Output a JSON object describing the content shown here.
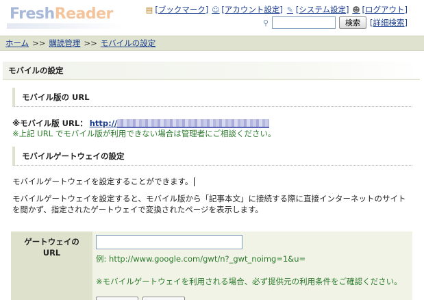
{
  "header": {
    "logo_fresh": "Fresh",
    "logo_reader": "Reader",
    "nav": [
      {
        "label": "[ブックマーク]",
        "icon": "bookmark-icon"
      },
      {
        "label": "[アカウント設定]",
        "icon": "account-icon"
      },
      {
        "label": "[システム設定]",
        "icon": "wrench-icon"
      },
      {
        "label": "[ログアウト]",
        "icon": "logout-icon"
      }
    ],
    "search": {
      "placeholder": "",
      "button": "検索",
      "advanced": "[詳細検索]"
    }
  },
  "breadcrumb": {
    "items": [
      "ホーム",
      "購読管理",
      "モバイルの設定"
    ],
    "separator": ">>"
  },
  "page": {
    "title": "モバイルの設定",
    "section1_title": "モバイル版の URL",
    "url_label": "※モバイル版 URL：",
    "url_prefix": "http://",
    "url_note": "※上記 URL でモバイル版が利用できない場合は管理者にご相談ください。",
    "section2_title": "モバイルゲートウェイの設定",
    "para1": "モバイルゲートウェイを設定することができます。",
    "para2": "モバイルゲートウェイを設定すると、モバイル版から「記事本文」に接続する際に直接インターネットのサイトを閲かず、指定されたゲートウェイで変換されたページを表示します。"
  },
  "form": {
    "label_line1": "ゲートウェイの",
    "label_line2": "URL",
    "input_value": "",
    "example": "例: http://www.google.com/gwt/n?_gwt_noimg=1&u=",
    "note": "※モバイルゲートウェイを利用される場合、必ず提供元の利用条件をご確認ください。"
  },
  "colors": {
    "link": "#1a3d8f",
    "note_green": "#2b7a2b",
    "breadcrumb_bg": "#dee2ce",
    "form_label_bg": "#dee1cc"
  }
}
